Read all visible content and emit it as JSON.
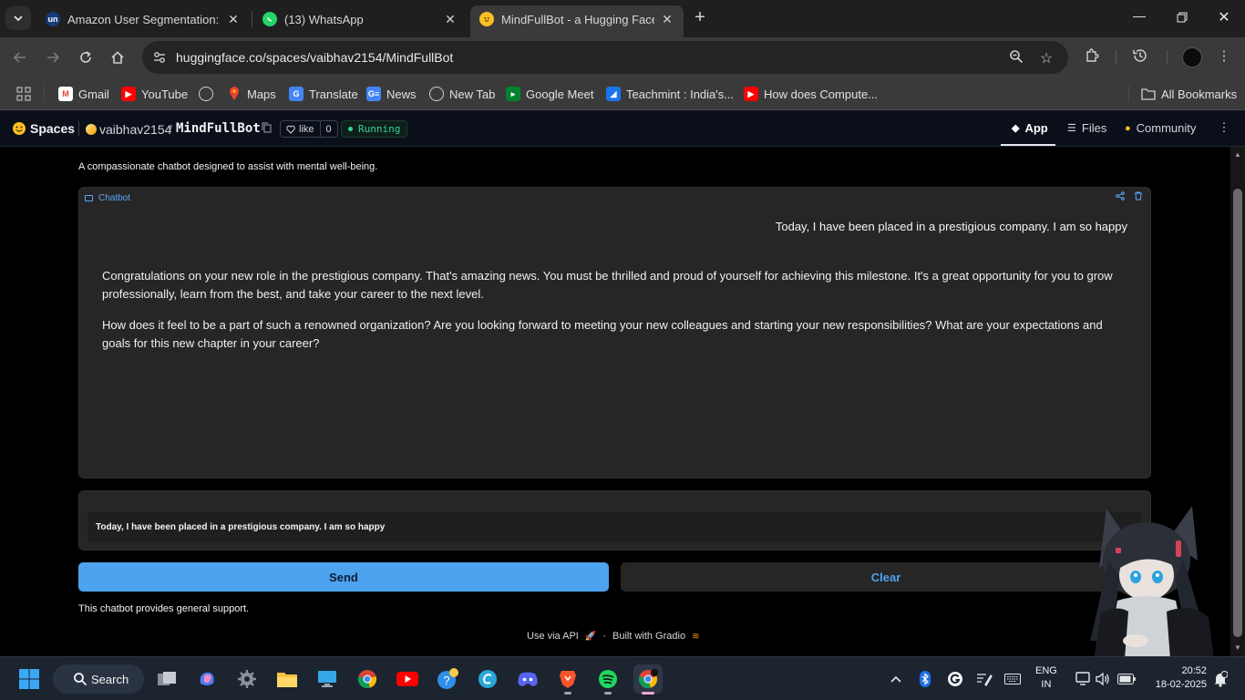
{
  "browser": {
    "tabs": [
      {
        "favicon": "un",
        "title": "Amazon User Segmentation: AI"
      },
      {
        "favicon": "whatsapp-icon",
        "title": "(13) WhatsApp"
      },
      {
        "favicon": "hf-icon",
        "title": "MindFullBot - a Hugging Face S"
      }
    ],
    "url": "huggingface.co/spaces/vaibhav2154/MindFullBot",
    "bookmarks": [
      {
        "icon": "gmail-icon",
        "label": "Gmail"
      },
      {
        "icon": "youtube-icon",
        "label": "YouTube"
      },
      {
        "icon": "globe-icon",
        "label": ""
      },
      {
        "icon": "maps-icon",
        "label": "Maps"
      },
      {
        "icon": "translate-icon",
        "label": "Translate"
      },
      {
        "icon": "news-icon",
        "label": "News"
      },
      {
        "icon": "globe-icon",
        "label": "New Tab"
      },
      {
        "icon": "meet-icon",
        "label": "Google Meet"
      },
      {
        "icon": "teachmint-icon",
        "label": "Teachmint : India's..."
      },
      {
        "icon": "youtube-icon",
        "label": "How does Compute..."
      }
    ],
    "all_bookmarks": "All Bookmarks"
  },
  "hf": {
    "spaces": "Spaces",
    "owner": "vaibhav2154",
    "slash": "/",
    "repo": "MindFullBot",
    "like_label": "like",
    "like_count": "0",
    "status": "Running",
    "nav": [
      "App",
      "Files",
      "Community"
    ]
  },
  "app": {
    "description": "A compassionate chatbot designed to assist with mental well-being.",
    "chatbot_label": "Chatbot",
    "user_message": "Today, I have been placed in a prestigious company. I am so happy",
    "bot_paragraphs": [
      "Congratulations on your new role in the prestigious company. That's amazing news. You must be thrilled and proud of yourself for achieving this milestone. It's a great opportunity for you to grow professionally, learn from the best, and take your career to the next level.",
      "How does it feel to be a part of such a renowned organization? Are you looking forward to meeting your new colleagues and starting your new responsibilities? What are your expectations and goals for this new chapter in your career?"
    ],
    "input_value": "Today, I have been placed in a prestigious company. I am so happy",
    "send_label": "Send",
    "clear_label": "Clear",
    "footer_note": "This chatbot provides general support.",
    "use_api": "Use via API",
    "dot": "·",
    "built_with": "Built with Gradio"
  },
  "taskbar": {
    "search_label": "Search",
    "lang": "ENG",
    "region": "IN",
    "time": "20:52",
    "date": "18-02-2025"
  },
  "colors": {
    "accent": "#4da3ee",
    "running": "#34d399"
  }
}
